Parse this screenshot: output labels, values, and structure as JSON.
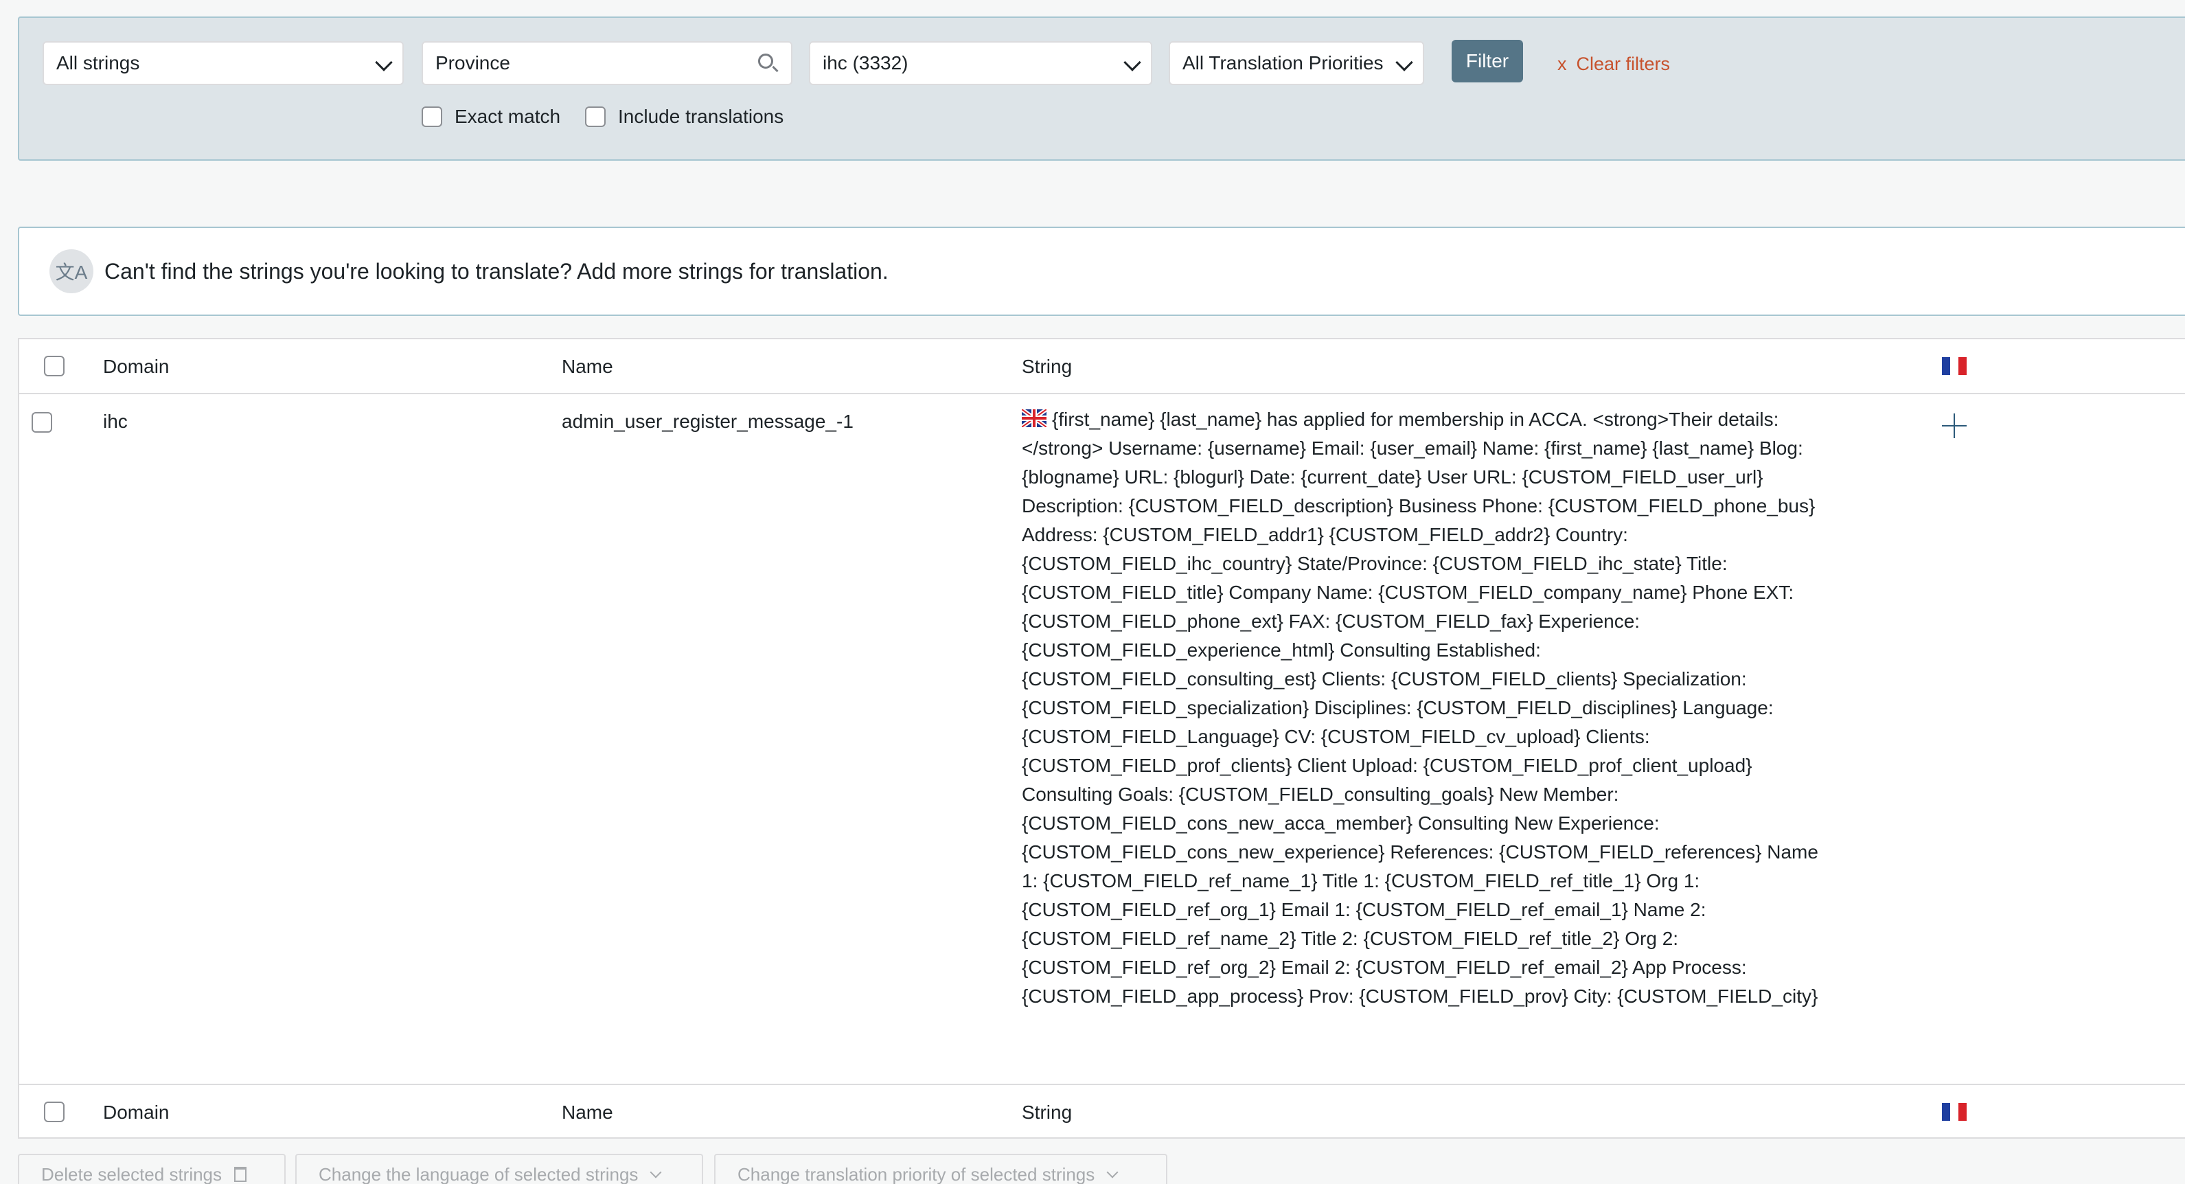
{
  "filters": {
    "strings_select": "All strings",
    "search_value": "Province",
    "domain_select": "ihc (3332)",
    "priority_select": "All Translation Priorities",
    "filter_button": "Filter",
    "clear_x": "x",
    "clear_label": "Clear filters",
    "exact_match_label": "Exact match",
    "include_translations_label": "Include translations"
  },
  "notice": {
    "icon": "translate-icon",
    "icon_glyph": "文A",
    "text": "Can't find the strings you're looking to translate? Add more strings for translation."
  },
  "table": {
    "headers": {
      "domain": "Domain",
      "name": "Name",
      "string": "String"
    },
    "target_flag": "flag-fr",
    "rows": [
      {
        "domain": "ihc",
        "name": "admin_user_register_message_-1",
        "source_flag": "flag-uk",
        "string": "{first_name} {last_name} has applied for membership in ACCA. <strong>Their details:</strong> Username: {username} Email: {user_email} Name: {first_name} {last_name} Blog: {blogname} URL: {blogurl} Date: {current_date} User URL: {CUSTOM_FIELD_user_url} Description: {CUSTOM_FIELD_description} Business Phone: {CUSTOM_FIELD_phone_bus} Address: {CUSTOM_FIELD_addr1} {CUSTOM_FIELD_addr2} Country: {CUSTOM_FIELD_ihc_country} State/Province: {CUSTOM_FIELD_ihc_state} Title: {CUSTOM_FIELD_title} Company Name: {CUSTOM_FIELD_company_name} Phone EXT: {CUSTOM_FIELD_phone_ext} FAX: {CUSTOM_FIELD_fax} Experience: {CUSTOM_FIELD_experience_html} Consulting Established: {CUSTOM_FIELD_consulting_est} Clients: {CUSTOM_FIELD_clients} Specialization: {CUSTOM_FIELD_specialization} Disciplines: {CUSTOM_FIELD_disciplines} Language: {CUSTOM_FIELD_Language} CV: {CUSTOM_FIELD_cv_upload} Clients: {CUSTOM_FIELD_prof_clients} Client Upload: {CUSTOM_FIELD_prof_client_upload} Consulting Goals: {CUSTOM_FIELD_consulting_goals} New Member: {CUSTOM_FIELD_cons_new_acca_member} Consulting New Experience: {CUSTOM_FIELD_cons_new_experience} References: {CUSTOM_FIELD_references} Name 1: {CUSTOM_FIELD_ref_name_1} Title 1: {CUSTOM_FIELD_ref_title_1} Org 1: {CUSTOM_FIELD_ref_org_1} Email 1: {CUSTOM_FIELD_ref_email_1} Name 2: {CUSTOM_FIELD_ref_name_2} Title 2: {CUSTOM_FIELD_ref_title_2} Org 2: {CUSTOM_FIELD_ref_org_2} Email 2: {CUSTOM_FIELD_ref_email_2} App Process: {CUSTOM_FIELD_app_process} Prov: {CUSTOM_FIELD_prov} City: {CUSTOM_FIELD_city}"
      }
    ]
  },
  "bulk_actions": {
    "delete": "Delete selected strings",
    "change_language": "Change the language of selected strings",
    "change_priority": "Change translation priority of selected strings"
  },
  "colors": {
    "filter_button": "#557587",
    "clear_link": "#c7522d",
    "panel_bg": "#dde4e8",
    "panel_border": "#a7c6d1",
    "plus_icon": "#2c5a7a"
  }
}
